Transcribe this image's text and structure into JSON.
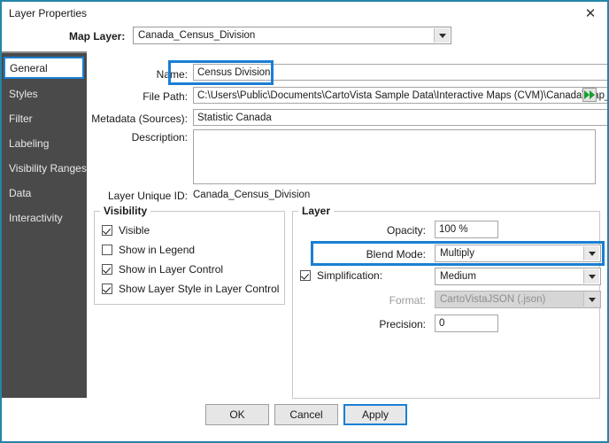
{
  "window": {
    "title": "Layer Properties",
    "close_icon": "close-icon",
    "accent_color": "#1a7fd4",
    "border_color": "#2484a8",
    "sidebar_color": "#4a4a4a"
  },
  "map_layer": {
    "label": "Map Layer:",
    "value": "Canada_Census_Division"
  },
  "sidebar": {
    "items": [
      {
        "label": "General",
        "active": true
      },
      {
        "label": "Styles",
        "active": false
      },
      {
        "label": "Filter",
        "active": false
      },
      {
        "label": "Labeling",
        "active": false
      },
      {
        "label": "Visibility Ranges",
        "active": false
      },
      {
        "label": "Data",
        "active": false
      },
      {
        "label": "Interactivity",
        "active": false
      }
    ]
  },
  "general": {
    "name": {
      "label": "Name:",
      "value": "Census Division"
    },
    "file_path": {
      "label": "File Path:",
      "value": "C:\\Users\\Public\\Documents\\CartoVista Sample Data\\Interactive Maps (CVM)\\Canada\\Map_files\\C",
      "browse_icon": "double-right-arrow-icon"
    },
    "metadata": {
      "label": "Metadata (Sources):",
      "value": "Statistic Canada"
    },
    "description": {
      "label": "Description:",
      "value": ""
    },
    "unique_id": {
      "label": "Layer Unique ID:",
      "value": "Canada_Census_Division"
    }
  },
  "visibility": {
    "title": "Visibility",
    "checkboxes": [
      {
        "label": "Visible",
        "checked": true
      },
      {
        "label": "Show in Legend",
        "checked": false
      },
      {
        "label": "Show in Layer Control",
        "checked": true
      },
      {
        "label": "Show Layer Style in Layer Control",
        "checked": true
      }
    ]
  },
  "layer": {
    "title": "Layer",
    "opacity": {
      "label": "Opacity:",
      "value": "100 %"
    },
    "blend_mode": {
      "label": "Blend Mode:",
      "value": "Multiply",
      "highlighted": true
    },
    "simplification": {
      "label": "Simplification:",
      "value": "Medium",
      "checked": true
    },
    "format": {
      "label": "Format:",
      "value": "CartoVistaJSON (.json)",
      "disabled": true
    },
    "precision": {
      "label": "Precision:",
      "value": "0"
    }
  },
  "footer": {
    "ok": "OK",
    "cancel": "Cancel",
    "apply": "Apply"
  }
}
